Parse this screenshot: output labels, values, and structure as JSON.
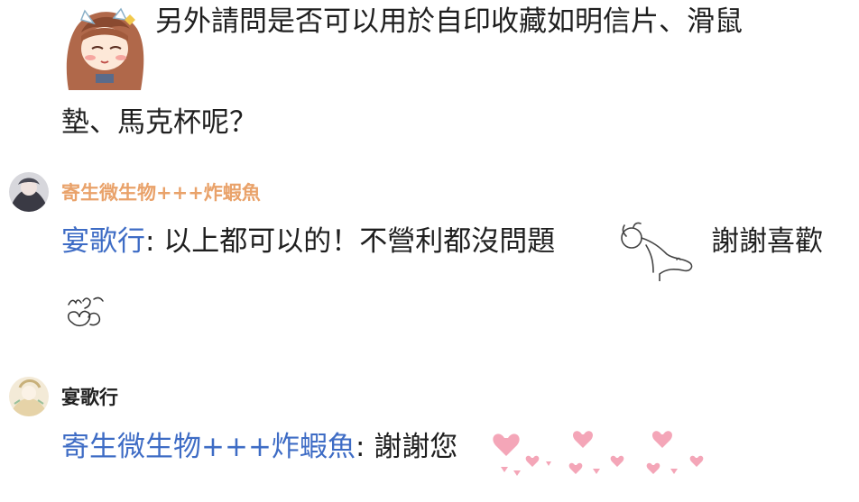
{
  "comment1": {
    "line1": "另外請問是否可以用於自印收藏如明信片、滑鼠",
    "line2": "墊、馬克杯呢？"
  },
  "reply1": {
    "author": "寄生微生物+++炸蝦魚",
    "author_color": "#e9a26a",
    "mention": "宴歌行",
    "separator": ":",
    "text": " 以上都可以的！不營利都沒問題",
    "text_after": "謝謝喜歡",
    "sticker_icon": "ok-hand-sticker"
  },
  "reply2": {
    "author": "宴歌行",
    "mention": "寄生微生物+++炸蝦魚",
    "separator": ":",
    "text": " 謝謝您",
    "sticker_icon": "pink-hearts-sticker"
  },
  "colors": {
    "mention": "#3e6cc5",
    "text": "#1f1f1f",
    "background": "#ffffff"
  }
}
